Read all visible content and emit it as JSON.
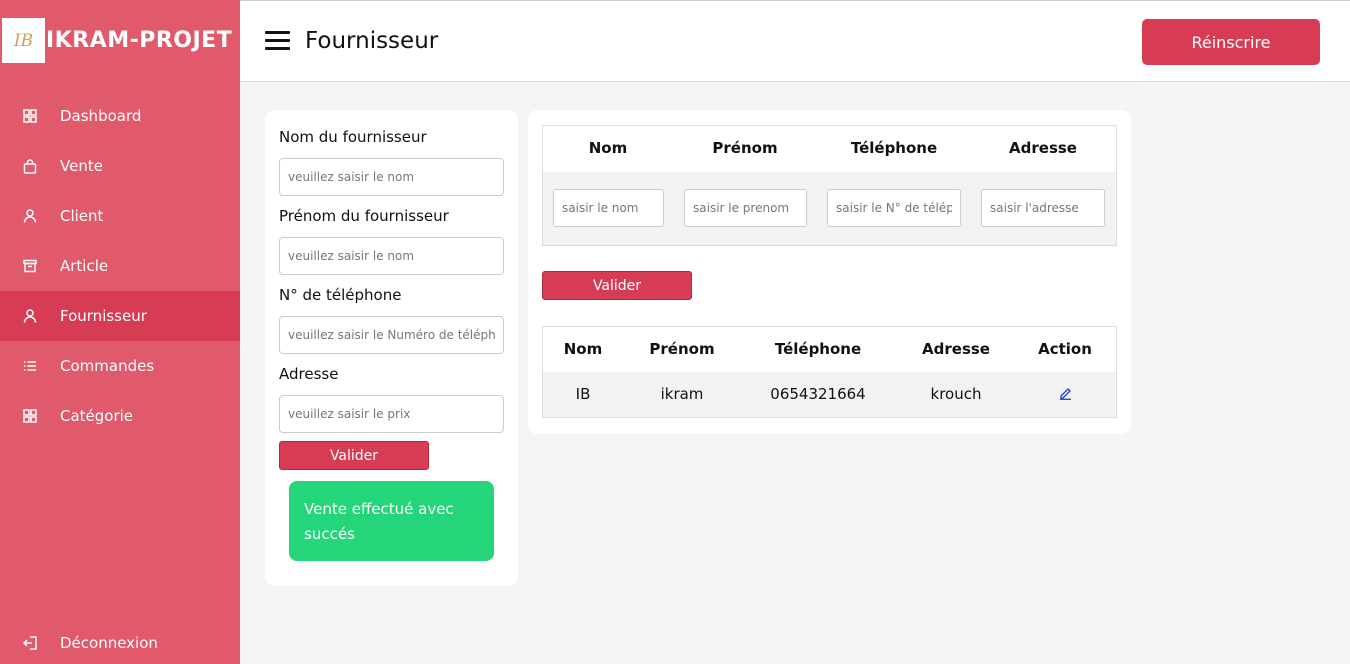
{
  "brand": {
    "logo_text": "IB",
    "title": "IKRAM-PROJET"
  },
  "sidebar": {
    "items": [
      {
        "label": "Dashboard",
        "icon": "grid-icon"
      },
      {
        "label": "Vente",
        "icon": "shopping-bag-icon"
      },
      {
        "label": "Client",
        "icon": "user-icon"
      },
      {
        "label": "Article",
        "icon": "archive-icon"
      },
      {
        "label": "Fournisseur",
        "icon": "user-icon",
        "active": true
      },
      {
        "label": "Commandes",
        "icon": "list-icon"
      },
      {
        "label": "Catégorie",
        "icon": "grid-icon"
      }
    ],
    "logout": {
      "label": "Déconnexion",
      "icon": "logout-icon"
    }
  },
  "header": {
    "title": "Fournisseur",
    "reinscrire_label": "Réinscrire"
  },
  "form": {
    "nom_label": "Nom du fournisseur",
    "nom_placeholder": "veuillez saisir le nom",
    "prenom_label": "Prénom du fournisseur",
    "prenom_placeholder": "veuillez saisir le nom",
    "tel_label": "N° de téléphone",
    "tel_placeholder": "veuillez saisir le Numéro de téléphone",
    "adresse_label": "Adresse",
    "adresse_placeholder": "veuillez saisir le prix",
    "submit_label": "Valider",
    "success_message": "Vente effectué avec succés"
  },
  "filter": {
    "headers": [
      "Nom",
      "Prénom",
      "Téléphone",
      "Adresse"
    ],
    "placeholders": [
      "saisir le nom",
      "saisir le prenom",
      "saisir le N° de téléphone",
      "saisir l'adresse"
    ],
    "submit_label": "Valider"
  },
  "results": {
    "headers": [
      "Nom",
      "Prénom",
      "Téléphone",
      "Adresse",
      "Action"
    ],
    "rows": [
      {
        "nom": "IB",
        "prenom": "ikram",
        "telephone": "0654321664",
        "adresse": "krouch",
        "action_icon": "edit-icon"
      }
    ]
  },
  "colors": {
    "sidebar_bg": "#e05a6b",
    "sidebar_active": "#d63d55",
    "accent": "#d63d55",
    "success": "#24d57a"
  }
}
